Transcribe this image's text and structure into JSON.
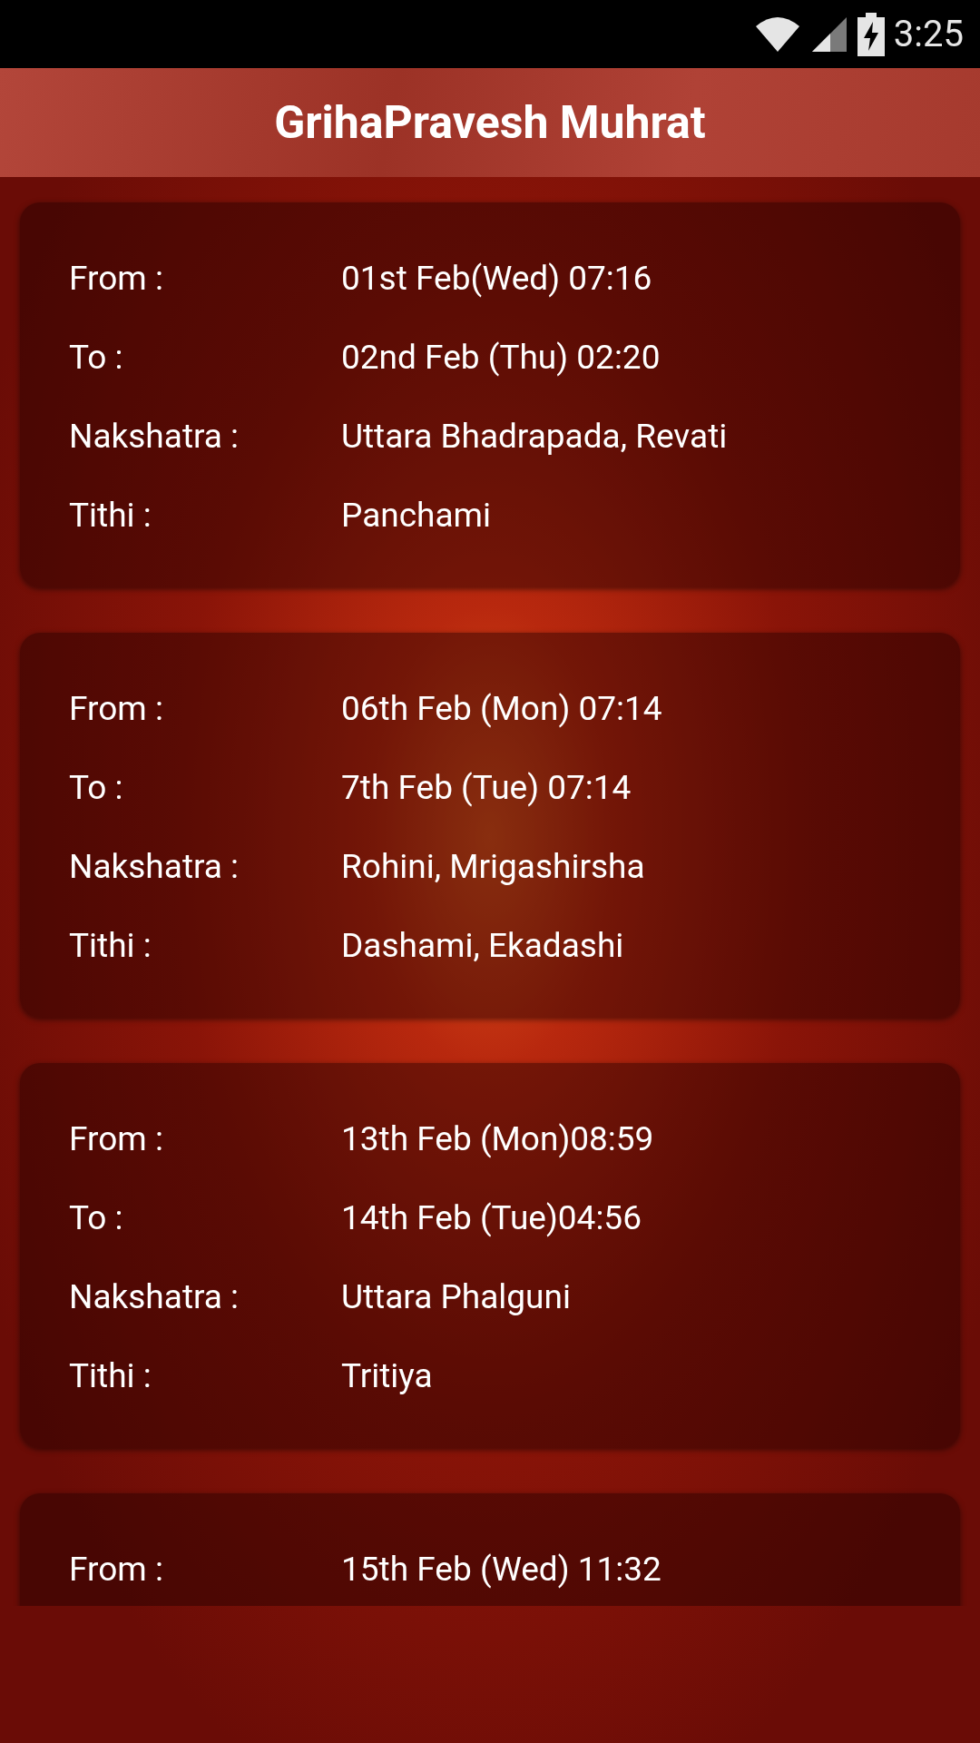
{
  "status_bar": {
    "time": "3:25"
  },
  "header": {
    "title": "GrihaPravesh Muhrat"
  },
  "muhurats": [
    {
      "rows": [
        {
          "label": "From :",
          "value": "01st Feb(Wed) 07:16"
        },
        {
          "label": "To :",
          "value": "02nd Feb (Thu) 02:20"
        },
        {
          "label": "Nakshatra :",
          "value": "Uttara Bhadrapada, Revati"
        },
        {
          "label": "Tithi :",
          "value": "Panchami"
        }
      ]
    },
    {
      "rows": [
        {
          "label": "From :",
          "value": "06th Feb (Mon) 07:14"
        },
        {
          "label": "To :",
          "value": "7th Feb (Tue) 07:14"
        },
        {
          "label": "Nakshatra :",
          "value": "Rohini, Mrigashirsha"
        },
        {
          "label": "Tithi :",
          "value": "Dashami, Ekadashi"
        }
      ]
    },
    {
      "rows": [
        {
          "label": "From :",
          "value": "13th Feb (Mon)08:59"
        },
        {
          "label": "To :",
          "value": "14th Feb (Tue)04:56"
        },
        {
          "label": "Nakshatra :",
          "value": "Uttara Phalguni"
        },
        {
          "label": "Tithi :",
          "value": "Tritiya"
        }
      ]
    },
    {
      "rows": [
        {
          "label": "From :",
          "value": "15th Feb (Wed) 11:32"
        }
      ]
    }
  ]
}
